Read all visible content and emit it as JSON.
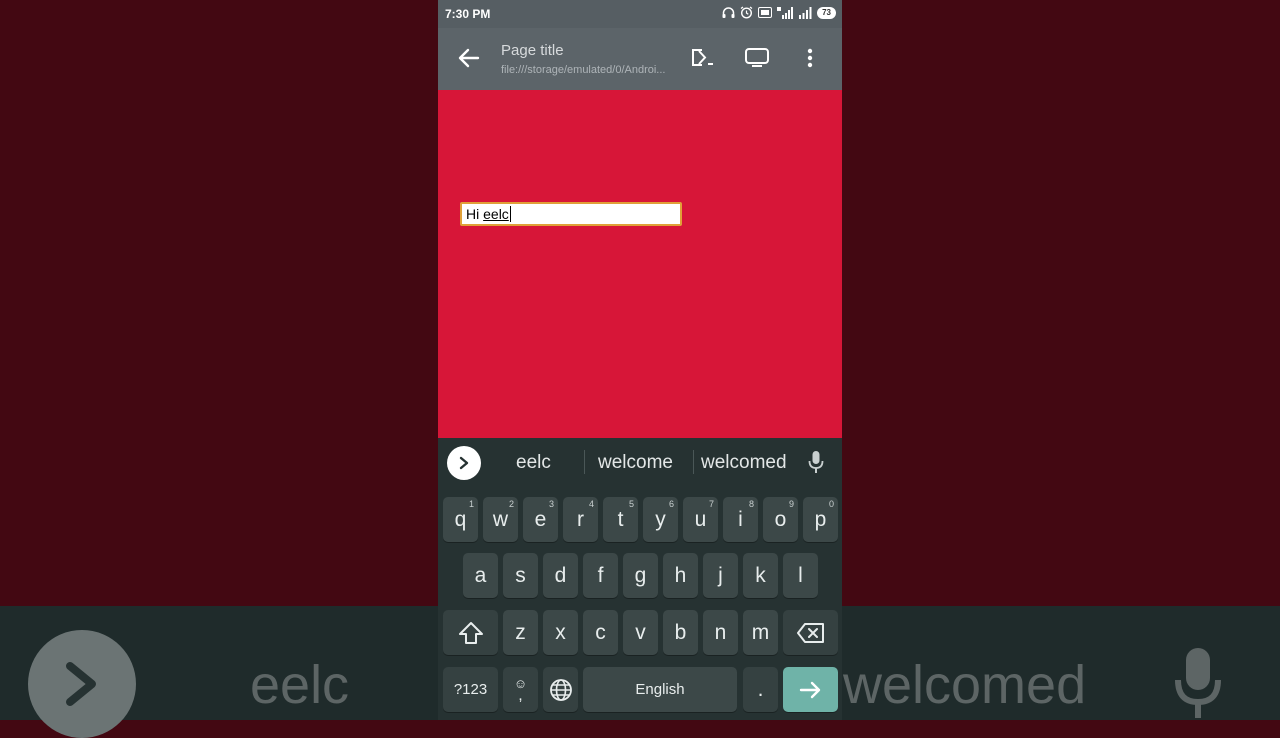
{
  "status_bar": {
    "time": "7:30 PM",
    "battery": "73",
    "network": "4G"
  },
  "toolbar": {
    "title": "Page title",
    "url": "file:///storage/emulated/0/Androi..."
  },
  "input": {
    "prefix": "Hi ",
    "composing": "eelc"
  },
  "suggestions": [
    "eelc",
    "welcome",
    "welcomed"
  ],
  "keyboard": {
    "row1": [
      {
        "k": "q",
        "n": "1"
      },
      {
        "k": "w",
        "n": "2"
      },
      {
        "k": "e",
        "n": "3"
      },
      {
        "k": "r",
        "n": "4"
      },
      {
        "k": "t",
        "n": "5"
      },
      {
        "k": "y",
        "n": "6"
      },
      {
        "k": "u",
        "n": "7"
      },
      {
        "k": "i",
        "n": "8"
      },
      {
        "k": "o",
        "n": "9"
      },
      {
        "k": "p",
        "n": "0"
      }
    ],
    "row2": [
      "a",
      "s",
      "d",
      "f",
      "g",
      "h",
      "j",
      "k",
      "l"
    ],
    "row3": [
      "z",
      "x",
      "c",
      "v",
      "b",
      "n",
      "m"
    ],
    "symbols_label": "?123",
    "emoji_label": "☺",
    "comma_label": ",",
    "space_label": "English",
    "period_label": "."
  },
  "background": {
    "left_word": "eelc",
    "right_word": "welcomed"
  },
  "colors": {
    "page_bg": "#d71638",
    "toolbar": "#5c6469",
    "keyboard": "#263232",
    "enter_key": "#6fb3a8",
    "input_border": "#e0a038"
  }
}
